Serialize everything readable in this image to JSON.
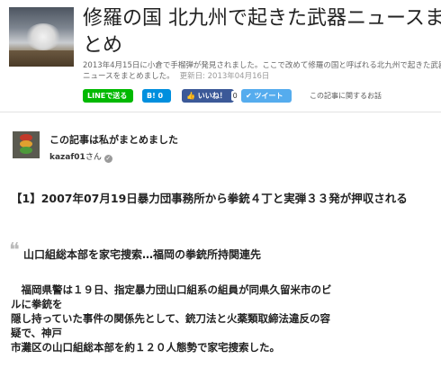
{
  "header": {
    "title_line1": "修羅の国 北九州で起きた武器ニュースま",
    "title_line2": "とめ",
    "summary_line1": "2013年4月15日に小倉で手榴弾が発見されました。ここで改めて修羅の国と呼ばれる北九州で起きた武器",
    "summary_line2": "ニュースをまとめました。",
    "updated": "更新日: 2013年04月16日"
  },
  "share": {
    "line_label": "LINEで送る",
    "hatena_label": "B!",
    "hatena_count": "0",
    "fb_label": "いいね！",
    "fb_count": "0",
    "tw_label": "ツイート",
    "related_label": "この記事に関するお話",
    "accent_line": "#00b900",
    "accent_hatena": "#008fde",
    "accent_fb": "#3b5998",
    "accent_tw": "#55acee"
  },
  "author": {
    "made_by": "この記事は私がまとめました",
    "name": "kazaf01",
    "suffix": "さん",
    "verified_icon": "check-badge-icon"
  },
  "article": {
    "heading": "【1】2007年07月19日暴力団事務所から拳銃４丁と実弾３３発が押収される",
    "quote_title": "山口組総本部を家宅捜索…福岡の拳銃所持関連先",
    "body_line1": "　福岡県警は１９日、指定暴力団山口組系の組員が同県久留米市のビ",
    "body_line2": "ルに拳銃を",
    "body_line3": "隠し持っていた事件の関係先として、銃刀法と火薬類取締法違反の容",
    "body_line4": "疑で、神戸",
    "body_line5": "市灘区の山口組総本部を約１２０人態勢で家宅捜索した。"
  }
}
